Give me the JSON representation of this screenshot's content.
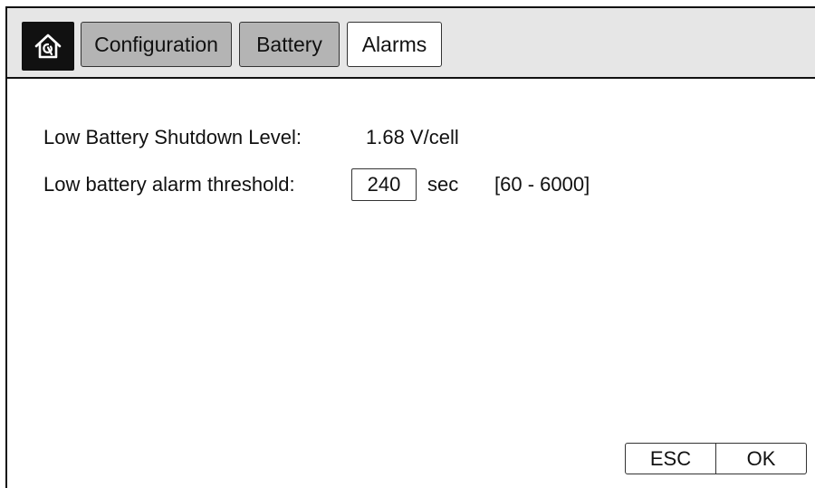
{
  "tabs": {
    "home": "home-icon",
    "configuration": "Configuration",
    "battery": "Battery",
    "alarms": "Alarms",
    "active": "Alarms"
  },
  "settings": {
    "shutdown_label": "Low Battery Shutdown Level:",
    "shutdown_value": "1.68 V/cell",
    "threshold_label": "Low battery alarm threshold:",
    "threshold_value": "240",
    "threshold_unit": "sec",
    "threshold_range": "[60 - 6000]"
  },
  "actions": {
    "esc": "ESC",
    "ok": "OK"
  },
  "colors": {
    "tabbar_bg": "#e6e6e6",
    "tab_inactive": "#b4b4b4",
    "tab_active": "#ffffff",
    "home_bg": "#111111"
  }
}
